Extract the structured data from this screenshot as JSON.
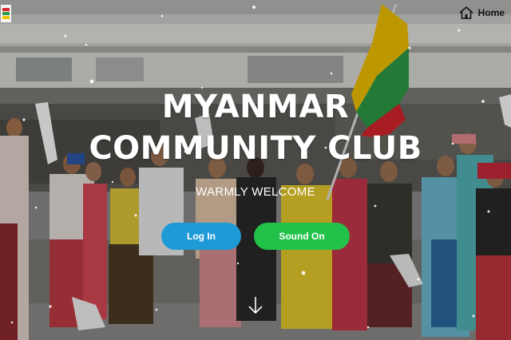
{
  "nav": {
    "home_label": "Home",
    "home_icon": "home-icon"
  },
  "logo": {
    "name": "club-logo"
  },
  "hero": {
    "title_line1": "MYANMAR",
    "title_line2": "COMMUNITY CLUB",
    "subtitle": "WARMLY WELCOME",
    "login_label": "Log In",
    "sound_label": "Sound On",
    "scroll_icon": "arrow-down-icon"
  },
  "colors": {
    "login_button": "#1e9ad6",
    "sound_button": "#22c24a",
    "flag_yellow": "#f2c200",
    "flag_green": "#2e9b46",
    "flag_red": "#d8262c"
  }
}
